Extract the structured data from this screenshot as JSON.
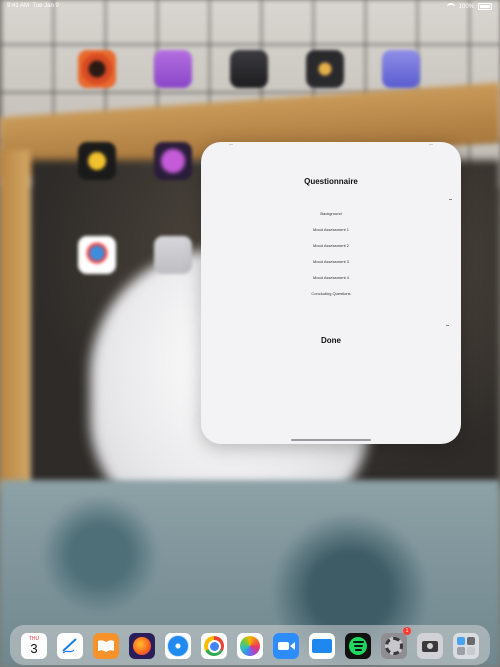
{
  "status_bar": {
    "time": "9:41 AM",
    "date": "Tue Jan 9",
    "battery": "100%"
  },
  "modal": {
    "title": "Questionnaire",
    "items": [
      "Background",
      "Mood Assessment 1",
      "Mood Assessment 2",
      "Mood Assessment 3",
      "Mood Assessment 4",
      "Concluding Questions"
    ],
    "done_label": "Done"
  },
  "dock": {
    "calendar": {
      "weekday": "THU",
      "day": "3"
    },
    "badge_count": "1",
    "apps": [
      "calendar",
      "freeform",
      "books",
      "firefox",
      "safari",
      "chrome",
      "photos",
      "zoom",
      "files",
      "spotify",
      "settings",
      "camera",
      "app-library"
    ]
  },
  "colors": {
    "modal_bg": "#f3f3f6",
    "dock_bg": "#cdd2d4",
    "badge": "#ff3b30"
  }
}
